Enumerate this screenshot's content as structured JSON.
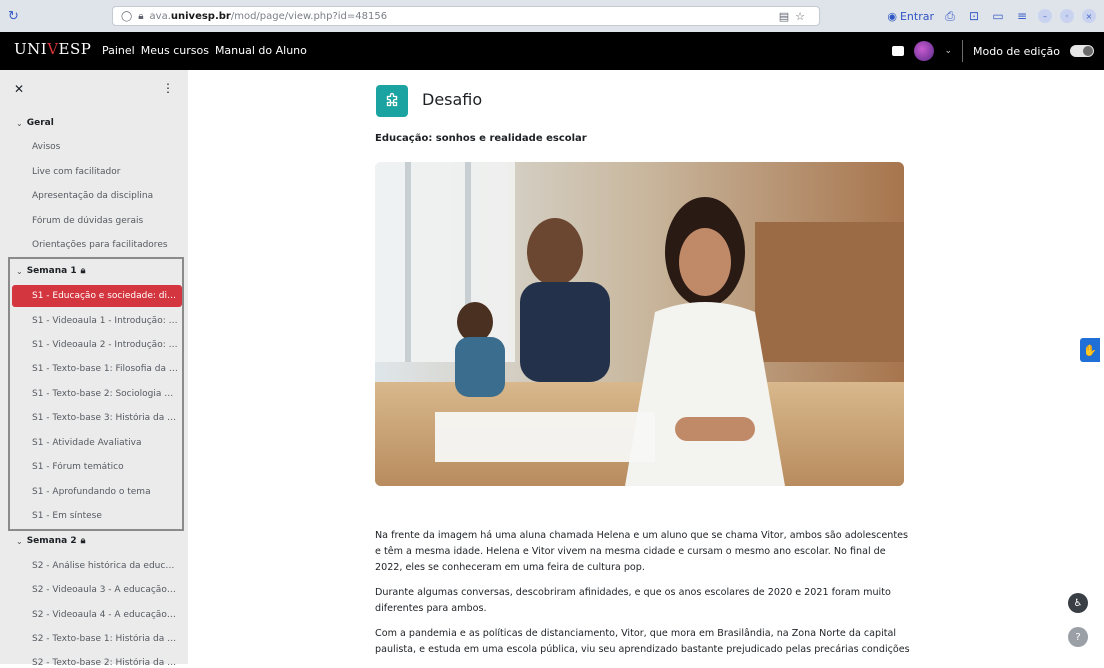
{
  "browser": {
    "url_prefix": "ava.",
    "url_domain": "univesp.br",
    "url_path": "/mod/page/view.php?id=48156",
    "entrar_label": "Entrar"
  },
  "navbar": {
    "logo": "UNIVESP",
    "links": [
      "Painel",
      "Meus cursos",
      "Manual do Aluno"
    ],
    "edit_mode_label": "Modo de edição"
  },
  "sidebar": {
    "sections": [
      {
        "title": "Geral",
        "items": [
          "Avisos",
          "Live com facilitador",
          "Apresentação da disciplina",
          "Fórum de dúvidas gerais",
          "Orientações para facilitadores"
        ]
      },
      {
        "title": "Semana 1",
        "items": [
          "S1 - Educação e sociedade: difer...",
          "S1 - Videoaula 1 - Introdução: As ...",
          "S1 - Videoaula 2 - Introdução: As ...",
          "S1 - Texto-base 1: Filosofia da Ed...",
          "S1 - Texto-base 2: Sociologia da E...",
          "S1 - Texto-base 3: História da Ed...",
          "S1 - Atividade Avaliativa",
          "S1 - Fórum temático",
          "S1 - Aprofundando o tema",
          "S1 - Em síntese"
        ]
      },
      {
        "title": "Semana 2",
        "items": [
          "S2 - Análise histórica da educaçã...",
          "S2 - Videoaula 3 - A educação no ...",
          "S2 - Videoaula 4 - A educação no ...",
          "S2 - Texto-base 1: História da ed...",
          "S2 - Texto-base 2: História da Ed..."
        ]
      }
    ]
  },
  "main": {
    "title": "Desafio",
    "subtitle": "Educação: sonhos e realidade escolar",
    "paragraphs": [
      "Na frente da imagem há uma aluna chamada Helena e um aluno que se chama Vitor, ambos são adolescentes e têm a mesma idade. Helena e Vitor vivem na mesma cidade e cursam o mesmo ano escolar. No final de 2022, eles se conheceram em uma feira de cultura pop.",
      "Durante algumas conversas, descobriram afinidades, e que os anos escolares de 2020 e 2021 foram muito diferentes para ambos.",
      "Com a pandemia e as políticas de distanciamento, Vitor, que mora em Brasilândia, na Zona Norte da capital paulista, e estuda em uma escola pública, viu seu aprendizado bastante prejudicado pelas precárias condições"
    ]
  },
  "colors": {
    "navbar_bg": "#000000",
    "accent_red": "#d4363f",
    "page_icon_teal": "#1aa3a0",
    "sidebar_bg": "#ebebeb"
  }
}
